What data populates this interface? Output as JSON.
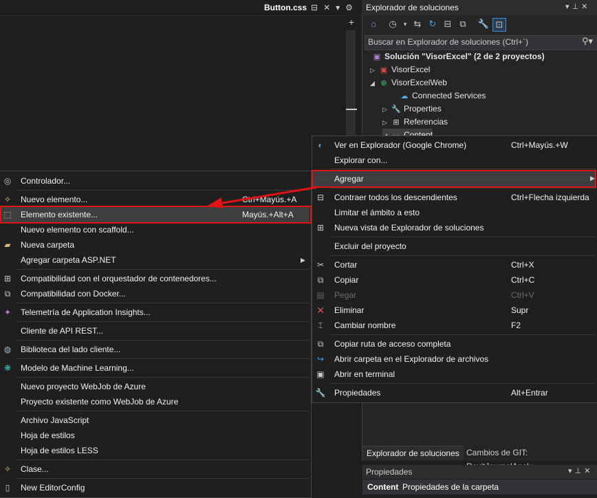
{
  "editor": {
    "tab_title": "Button.css",
    "tab_pin_icon": "pin-icon",
    "tab_close_icon": "close-icon"
  },
  "solution_explorer": {
    "title": "Explorador de soluciones",
    "search_placeholder": "Buscar en Explorador de soluciones (Ctrl+`)",
    "tree": [
      {
        "label": "Solución \"VisorExcel\"  (2 de 2 proyectos)",
        "icon": "solution-icon",
        "bold": true
      },
      {
        "label": "VisorExcel",
        "icon": "csharp-project-icon",
        "expander": "collapsed"
      },
      {
        "label": "VisorExcelWeb",
        "icon": "web-project-icon",
        "expander": "expanded"
      },
      {
        "label": "Connected Services",
        "icon": "connected-services-icon"
      },
      {
        "label": "Properties",
        "icon": "wrench-icon",
        "expander": "collapsed"
      },
      {
        "label": "Referencias",
        "icon": "references-icon",
        "expander": "collapsed"
      },
      {
        "label": "Content",
        "icon": "folder-icon",
        "expander": "expanded"
      }
    ],
    "bottom_tabs": {
      "explorer": "Explorador de soluciones",
      "git": "Cambios de GIT: RevitJournalAnaly..."
    }
  },
  "properties": {
    "title": "Propiedades",
    "object_kind": "Content",
    "object_desc": "Propiedades de la carpeta"
  },
  "context_menu": {
    "items": [
      {
        "label": "Ver en Explorador (Google Chrome)",
        "shortcut": "Ctrl+Mayús.+W",
        "icon": "browser-icon"
      },
      {
        "label": "Explorar con...",
        "shortcut": ""
      },
      {
        "label": "Agregar",
        "shortcut": "",
        "submenu": true,
        "highlighted": true
      },
      {
        "label": "Contraer todos los descendientes",
        "shortcut": "Ctrl+Flecha izquierda",
        "icon": "collapse-icon"
      },
      {
        "label": "Limitar el ámbito a esto",
        "shortcut": ""
      },
      {
        "label": "Nueva vista de Explorador de soluciones",
        "shortcut": "",
        "icon": "new-view-icon"
      },
      {
        "label": "Excluir del proyecto",
        "shortcut": ""
      },
      {
        "label": "Cortar",
        "shortcut": "Ctrl+X",
        "icon": "scissors-icon"
      },
      {
        "label": "Copiar",
        "shortcut": "Ctrl+C",
        "icon": "copy-icon"
      },
      {
        "label": "Pegar",
        "shortcut": "Ctrl+V",
        "icon": "paste-icon",
        "disabled": true
      },
      {
        "label": "Eliminar",
        "shortcut": "Supr",
        "icon": "delete-icon"
      },
      {
        "label": "Cambiar nombre",
        "shortcut": "F2",
        "icon": "rename-icon"
      },
      {
        "label": "Copiar ruta de acceso completa",
        "shortcut": "",
        "icon": "copy-path-icon"
      },
      {
        "label": "Abrir carpeta en el Explorador de archivos",
        "shortcut": "",
        "icon": "open-folder-icon"
      },
      {
        "label": "Abrir en terminal",
        "shortcut": "",
        "icon": "terminal-icon"
      },
      {
        "label": "Propiedades",
        "shortcut": "Alt+Entrar",
        "icon": "wrench-icon"
      }
    ]
  },
  "add_submenu": {
    "items": [
      {
        "label": "Controlador...",
        "shortcut": "",
        "icon": "controller-icon"
      },
      {
        "label": "Nuevo elemento...",
        "shortcut": "Ctrl+Mayús.+A",
        "icon": "new-item-icon"
      },
      {
        "label": "Elemento existente...",
        "shortcut": "Mayús.+Alt+A",
        "icon": "existing-item-icon",
        "highlighted": true
      },
      {
        "label": "Nuevo elemento con scaffold...",
        "shortcut": ""
      },
      {
        "label": "Nueva carpeta",
        "shortcut": "",
        "icon": "new-folder-icon"
      },
      {
        "label": "Agregar carpeta ASP.NET",
        "shortcut": "",
        "submenu": true
      },
      {
        "label": "Compatibilidad con el orquestador de contenedores...",
        "shortcut": "",
        "icon": "container-icon"
      },
      {
        "label": "Compatibilidad con Docker...",
        "shortcut": "",
        "icon": "docker-icon"
      },
      {
        "label": "Telemetría de Application Insights...",
        "shortcut": "",
        "icon": "insights-icon"
      },
      {
        "label": "Cliente de API REST...",
        "shortcut": ""
      },
      {
        "label": "Biblioteca del lado cliente...",
        "shortcut": "",
        "icon": "globe-icon"
      },
      {
        "label": "Modelo de Machine Learning...",
        "shortcut": "",
        "icon": "ml-icon"
      },
      {
        "label": "Nuevo proyecto WebJob de Azure",
        "shortcut": ""
      },
      {
        "label": "Proyecto existente como WebJob de Azure",
        "shortcut": ""
      },
      {
        "label": "Archivo JavaScript",
        "shortcut": ""
      },
      {
        "label": "Hoja de estilos",
        "shortcut": ""
      },
      {
        "label": "Hoja de estilos LESS",
        "shortcut": ""
      },
      {
        "label": "Clase...",
        "shortcut": "",
        "icon": "class-icon"
      },
      {
        "label": "New EditorConfig",
        "shortcut": "",
        "icon": "editorconfig-icon"
      }
    ]
  },
  "colors": {
    "highlight_border": "#e01414",
    "arrow": "#e01414",
    "accent": "#0e70c0"
  }
}
